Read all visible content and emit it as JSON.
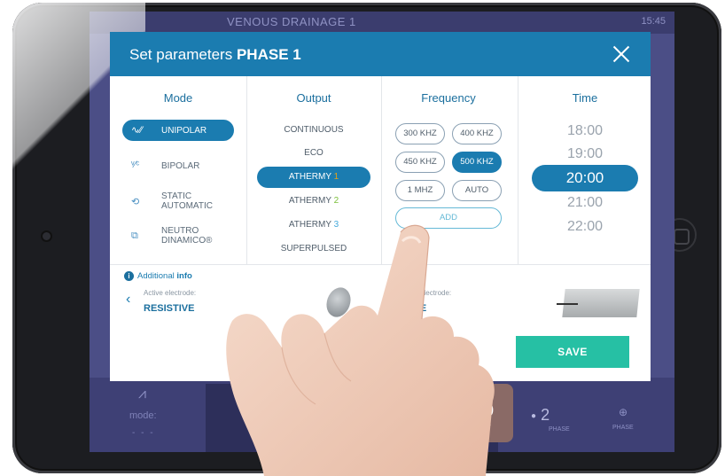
{
  "device": {
    "home_button_icon": "home-button-icon"
  },
  "app": {
    "title": "VENOUS DRAINAGE 1",
    "clock": "15:45",
    "bottom": {
      "mode_label": "mode:",
      "mode_value": "- - -",
      "phase_time_value": "20:00",
      "phase_time_label": "PHASE TIME",
      "phase_number": "2",
      "phase_label": "PHASE",
      "add_phase_label": "PHASE"
    }
  },
  "modal": {
    "title_prefix": "Set parameters",
    "title_phase": "PHASE 1",
    "columns": {
      "mode": "Mode",
      "output": "Output",
      "frequency": "Frequency",
      "time": "Time"
    },
    "modes": [
      {
        "label": "UNIPOLAR",
        "icon": "unipolar-icon",
        "selected": true
      },
      {
        "label": "BIPOLAR",
        "icon": "bipolar-icon",
        "selected": false
      },
      {
        "label_line1": "STATIC",
        "label_line2": "AUTOMATIC",
        "icon": "static-automatic-icon",
        "selected": false
      },
      {
        "label_line1": "NEUTRO",
        "label_line2": "DINAMICO®",
        "icon": "neutro-dinamico-icon",
        "selected": false
      }
    ],
    "outputs": [
      {
        "label": "CONTINUOUS",
        "selected": false
      },
      {
        "label": "ECO",
        "selected": false
      },
      {
        "label": "ATHERMY",
        "num": "1",
        "selected": true
      },
      {
        "label": "ATHERMY",
        "num": "2",
        "selected": false
      },
      {
        "label": "ATHERMY",
        "num": "3",
        "selected": false
      },
      {
        "label": "SUPERPULSED",
        "selected": false
      }
    ],
    "frequencies": [
      {
        "label": "300 KHZ",
        "selected": false
      },
      {
        "label": "400 KHZ",
        "selected": false
      },
      {
        "label": "450 KHZ",
        "selected": false
      },
      {
        "label": "500 KHZ",
        "selected": true
      },
      {
        "label": "1 MHZ",
        "selected": false
      },
      {
        "label": "AUTO",
        "selected": false
      }
    ],
    "frequency_add": "ADD",
    "times": [
      {
        "label": "18:00",
        "selected": false
      },
      {
        "label": "19:00",
        "selected": false
      },
      {
        "label": "20:00",
        "selected": true
      },
      {
        "label": "21:00",
        "selected": false
      },
      {
        "label": "22:00",
        "selected": false
      }
    ],
    "info": {
      "prefix": "Additional",
      "bold": "info"
    },
    "active_electrode": {
      "label": "Active electrode:",
      "value": "RESISTIVE"
    },
    "neutral_electrode": {
      "label": "Neutral electrode:",
      "value": "PLATE"
    },
    "save_label": "SAVE"
  },
  "colors": {
    "accent": "#1b7cb0",
    "save": "#26c0a4",
    "screen_bg": "#4b4e86"
  }
}
